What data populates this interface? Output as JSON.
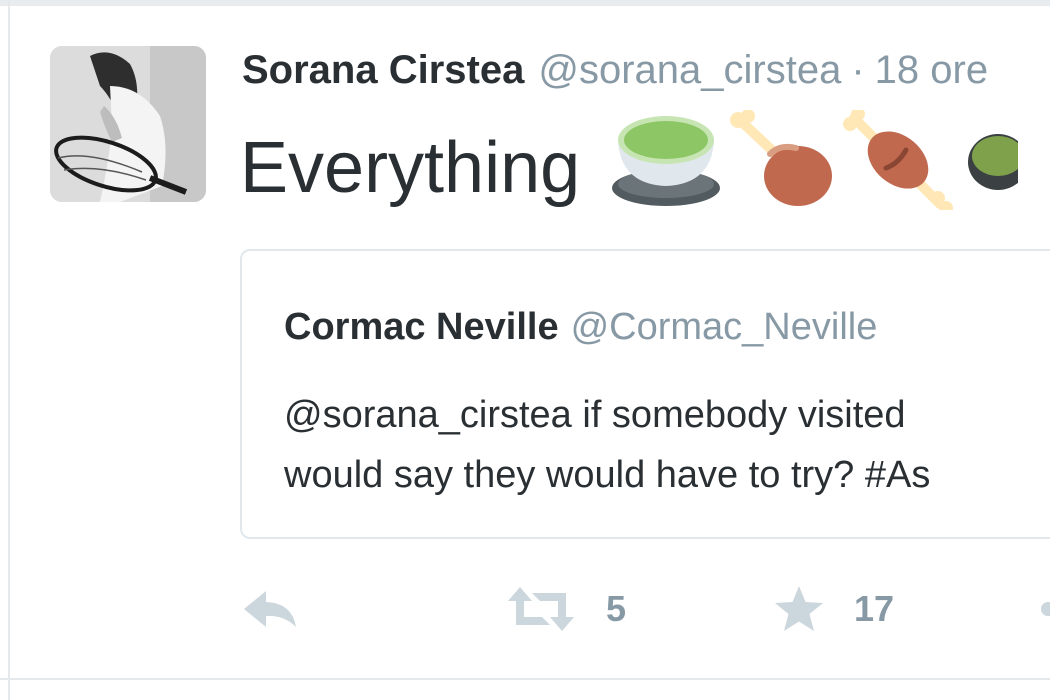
{
  "tweet": {
    "author_name": "Sorana Cirstea",
    "author_handle": "@sorana_cirstea",
    "separator": "·",
    "time": "18 ore",
    "text": "Everything",
    "emojis": [
      "green-bowl-emoji",
      "poultry-leg-emoji",
      "meat-on-bone-emoji",
      "partial-emoji"
    ]
  },
  "quoted_tweet": {
    "author_name": "Cormac Neville",
    "author_handle": "@Cormac_Neville",
    "text_line1": "@sorana_cirstea if somebody visited",
    "text_line2": "would say they would have to try? #As"
  },
  "actions": {
    "reply_icon": "reply-icon",
    "retweet_icon": "retweet-icon",
    "retweet_count": "5",
    "favorite_icon": "star-icon",
    "favorite_count": "17",
    "more_icon": "more-dots-icon"
  },
  "colors": {
    "text": "#292f33",
    "muted": "#8899a6",
    "border": "#e1e8ed",
    "icon": "#ccd6dd"
  }
}
